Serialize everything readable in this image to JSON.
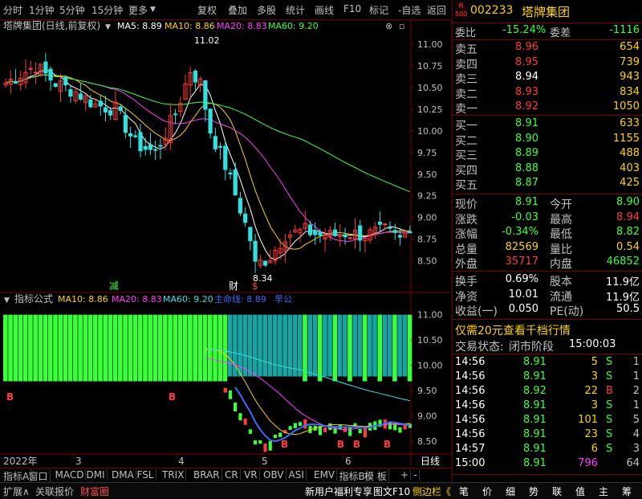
{
  "toolbar": {
    "left_items": [
      "分时",
      "1分钟",
      "5分钟",
      "15分钟",
      "更多"
    ],
    "right_items": [
      "复权",
      "叠加",
      "多股",
      "统计",
      "画线",
      "F10",
      "标记",
      "-自选",
      "返回"
    ]
  },
  "stock": {
    "code": "002233",
    "name": "塔牌集团",
    "badge_top": "R",
    "badge_bottom": "500"
  },
  "chart_header": {
    "title": "塔牌集团(日线,前复权)",
    "ma5": "MA5: 8.89",
    "ma10": "MA10: 8.86",
    "ma20": "MA20: 8.83",
    "ma60": "MA60: 9.20"
  },
  "indicator_header": {
    "title": "指标公式",
    "ma10": "MA10: 8.86",
    "ma20": "MA20: 8.83",
    "ma60": "MA60: 9.20",
    "main_line": "主命线: 8.89",
    "extra": "早公"
  },
  "chart_data": {
    "type": "candlestick",
    "price_axis": [
      "11.00",
      "10.75",
      "10.50",
      "10.25",
      "10.00",
      "9.75",
      "9.50",
      "9.25",
      "9.00",
      "8.75",
      "8.50"
    ],
    "lower_axis": [
      "11.00",
      "10.50",
      "10.00",
      "9.50",
      "9.00",
      "8.50"
    ],
    "ylim": [
      8.34,
      11.1
    ],
    "high_label": "11.02",
    "low_label": "8.34",
    "month_labels": [
      "2022年",
      "3",
      "4",
      "5",
      "6"
    ],
    "period_label": "日线",
    "markers": [
      {
        "text": "减",
        "color": "#3cff3c"
      },
      {
        "text": "财",
        "color": "#ffffff"
      },
      {
        "text": "$",
        "color": "#ff3b3b"
      }
    ],
    "lower_signals": [
      "B",
      "B",
      "B",
      "B",
      "B",
      "B",
      "B"
    ],
    "colors": {
      "up": "#ff3b3b",
      "down": "#33e0e0",
      "ma5": "#ffffff",
      "ma10": "#ffd400",
      "ma20": "#ff3cff",
      "ma60": "#3cff3c",
      "bar_green": "#3cff3c",
      "bar_teal": "#1aa3a3"
    }
  },
  "weibi": {
    "label1": "委比",
    "value1": "-15.24%",
    "label2": "委差",
    "value2": "-1116"
  },
  "asks": [
    {
      "label": "卖五",
      "price": "8.96",
      "vol": "654"
    },
    {
      "label": "卖四",
      "price": "8.95",
      "vol": "739"
    },
    {
      "label": "卖三",
      "price": "8.94",
      "vol": "943"
    },
    {
      "label": "卖二",
      "price": "8.93",
      "vol": "834"
    },
    {
      "label": "卖一",
      "price": "8.92",
      "vol": "1050"
    }
  ],
  "bids": [
    {
      "label": "买一",
      "price": "8.91",
      "vol": "633"
    },
    {
      "label": "买二",
      "price": "8.90",
      "vol": "1155"
    },
    {
      "label": "买三",
      "price": "8.89",
      "vol": "488"
    },
    {
      "label": "买四",
      "price": "8.88",
      "vol": "403"
    },
    {
      "label": "买五",
      "price": "8.87",
      "vol": "425"
    }
  ],
  "quote": [
    {
      "l1": "现价",
      "v1": "8.91",
      "l2": "今开",
      "v2": "8.90"
    },
    {
      "l1": "涨跌",
      "v1": "-0.03",
      "l2": "最高",
      "v2": "8.94"
    },
    {
      "l1": "涨幅",
      "v1": "-0.34%",
      "l2": "最低",
      "v2": "8.82"
    },
    {
      "l1": "总量",
      "v1": "82569",
      "l2": "量比",
      "v2": "0.54"
    },
    {
      "l1": "外盘",
      "v1": "35717",
      "l2": "内盘",
      "v2": "46852"
    }
  ],
  "stats": [
    {
      "l1": "换手",
      "v1": "0.69%",
      "l2": "股本",
      "v2": "11.9亿"
    },
    {
      "l1": "净资",
      "v1": "10.01",
      "l2": "流通",
      "v2": "11.9亿"
    },
    {
      "l1": "收益(一)",
      "v1": "0.050",
      "l2": "PE(动)",
      "v2": "50.5"
    }
  ],
  "promo": "仅需20元查看千档行情",
  "trade_status": {
    "label": "交易状态:",
    "value": "闭市阶段",
    "time": "15:00:03"
  },
  "ticks": [
    {
      "time": "14:56",
      "price": "8.91",
      "vol": "5",
      "side": "S",
      "n": "1"
    },
    {
      "time": "14:56",
      "price": "8.91",
      "vol": "3",
      "side": "S",
      "n": "1"
    },
    {
      "time": "14:56",
      "price": "8.92",
      "vol": "22",
      "side": "B",
      "n": "2"
    },
    {
      "time": "14:56",
      "price": "8.91",
      "vol": "3",
      "side": "S",
      "n": "1"
    },
    {
      "time": "14:56",
      "price": "8.91",
      "vol": "101",
      "side": "S",
      "n": "5"
    },
    {
      "time": "14:56",
      "price": "8.91",
      "vol": "23",
      "side": "S",
      "n": "4"
    },
    {
      "time": "14:57",
      "price": "8.91",
      "vol": "6",
      "side": "S",
      "n": "3"
    },
    {
      "time": "15:00",
      "price": "8.91",
      "vol": "796",
      "side": "",
      "n": "64"
    }
  ],
  "bottom_tabs": [
    "指标A",
    "窗口",
    "MACD",
    "DMI",
    "DMA",
    "FSL",
    "TRIX",
    "BRAR",
    "CR",
    "VR",
    "OBV",
    "ASI",
    "EMV",
    "指标B",
    "模 板",
    "+",
    "-"
  ],
  "status_left": [
    "扩展∧",
    "关联报价",
    "财富圈"
  ],
  "status_right": [
    "新用户福利专享",
    "图文F10",
    "侧边栏《"
  ],
  "panel_tabs": [
    "笔",
    "价",
    "细",
    "势",
    "联",
    "值",
    "主",
    "筹"
  ]
}
